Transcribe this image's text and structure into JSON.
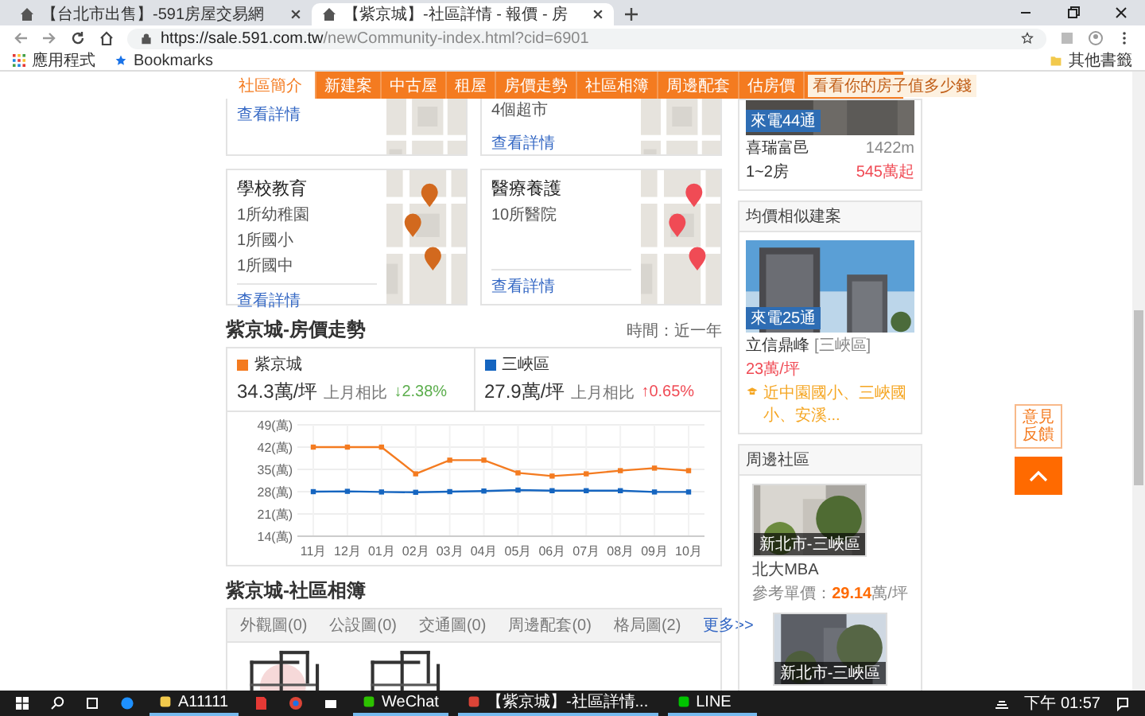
{
  "browser": {
    "tabs": [
      {
        "title": "【台北市出售】-591房屋交易網",
        "selected": false
      },
      {
        "title": "【紫京城】-社區詳情 - 報價 - 房",
        "selected": true
      }
    ],
    "url_host": "https://sale.591.com.tw",
    "url_path": "/newCommunity-index.html?cid=6901",
    "bookmarks": [
      {
        "label": "應用程式",
        "kind": "apps"
      },
      {
        "label": "Bookmarks",
        "kind": "star"
      }
    ],
    "other_bookmarks": "其他書籤"
  },
  "nav": {
    "items": [
      {
        "label": "社區簡介",
        "selected": true
      },
      {
        "label": "新建案",
        "selected": false
      },
      {
        "label": "中古屋",
        "selected": false
      },
      {
        "label": "租屋",
        "selected": false
      },
      {
        "label": "房價走勢",
        "selected": false
      },
      {
        "label": "社區相簿",
        "selected": false
      },
      {
        "label": "周邊配套",
        "selected": false
      },
      {
        "label": "估房價",
        "selected": false
      }
    ],
    "tooltip": "看看你的房子值多少錢"
  },
  "facilities": [
    {
      "link": "查看詳情"
    },
    {
      "lines": [
        "4個超市"
      ],
      "link": "查看詳情"
    },
    {
      "title": "學校教育",
      "lines": [
        "1所幼稚園",
        "1所國小",
        "1所國中"
      ],
      "link": "查看詳情"
    },
    {
      "title": "醫療養護",
      "lines": [
        "10所醫院"
      ],
      "link": "查看詳情"
    }
  ],
  "trend": {
    "title": "紫京城-房價走勢",
    "period": "時間：近一年",
    "stats": [
      {
        "price": "34.3萬/坪",
        "change_label": "上月相比",
        "change": "↓2.38%",
        "rising": false
      },
      {
        "price": "27.9萬/坪",
        "change_label": "上月相比",
        "change": "↑0.65%",
        "rising": true
      }
    ],
    "chart_data": {
      "type": "line",
      "grid": true,
      "categories": [
        "11月",
        "12月",
        "01月",
        "02月",
        "03月",
        "04月",
        "05月",
        "06月",
        "07月",
        "08月",
        "09月",
        "10月"
      ],
      "series": [
        {
          "name": "紫京城",
          "color": "#f47b20",
          "marker": "square",
          "values": [
            42,
            42,
            42,
            33.6,
            37.9,
            37.9,
            33.9,
            32.9,
            33.6,
            34.6,
            35.4,
            34.6
          ]
        },
        {
          "name": "三峽區",
          "color": "#1565c0",
          "marker": "square",
          "values": [
            28,
            28.1,
            27.9,
            27.8,
            28,
            28.2,
            28.5,
            28.3,
            28.3,
            28.3,
            27.9,
            27.9
          ]
        }
      ],
      "ylim": [
        14,
        49
      ],
      "yticks": [
        {
          "value": 49,
          "label": "49(萬)"
        },
        {
          "value": 42,
          "label": "42(萬)"
        },
        {
          "value": 35,
          "label": "35(萬)"
        },
        {
          "value": 28,
          "label": "28(萬)"
        },
        {
          "value": 21,
          "label": "21(萬)"
        },
        {
          "value": 14,
          "label": "14(萬)"
        }
      ]
    }
  },
  "album": {
    "title": "紫京城-社區相簿",
    "tabs": [
      {
        "label": "外觀圖(0)",
        "selected": false
      },
      {
        "label": "公設圖(0)",
        "selected": false
      },
      {
        "label": "交通圖(0)",
        "selected": false
      },
      {
        "label": "周邊配套(0)",
        "selected": false
      },
      {
        "label": "格局圖(2)",
        "selected": false
      }
    ],
    "more": "更多>>"
  },
  "sidebar": {
    "top_card": {
      "badge": "來電44通",
      "name": "喜瑞富邑",
      "distance": "1422m",
      "rooms": "1~2房",
      "price": "545萬起"
    },
    "similar": {
      "header": "均價相似建案",
      "badge": "來電25通",
      "name": "立信鼎峰",
      "area": "[三峽區]",
      "price": "23萬/坪",
      "feature": "近中園國小、三峽國小、安溪..."
    },
    "nearby": {
      "header": "周邊社區",
      "items": [
        {
          "caption": "新北市-三峽區",
          "name": "北大MBA",
          "price_label": "參考單價：",
          "price": "29.14",
          "unit": "萬/坪"
        },
        {
          "caption": "新北市-三峽區"
        }
      ]
    }
  },
  "floating": {
    "feedback": "意見反饋"
  },
  "taskbar": {
    "items": [
      {
        "label": "A11111",
        "kind": "folder"
      },
      {
        "label": "WeChat",
        "kind": "wechat"
      },
      {
        "label": "【紫京城】-社區詳情...",
        "kind": "chrome"
      },
      {
        "label": "LINE",
        "kind": "line"
      }
    ],
    "time": "下午 01:57"
  }
}
